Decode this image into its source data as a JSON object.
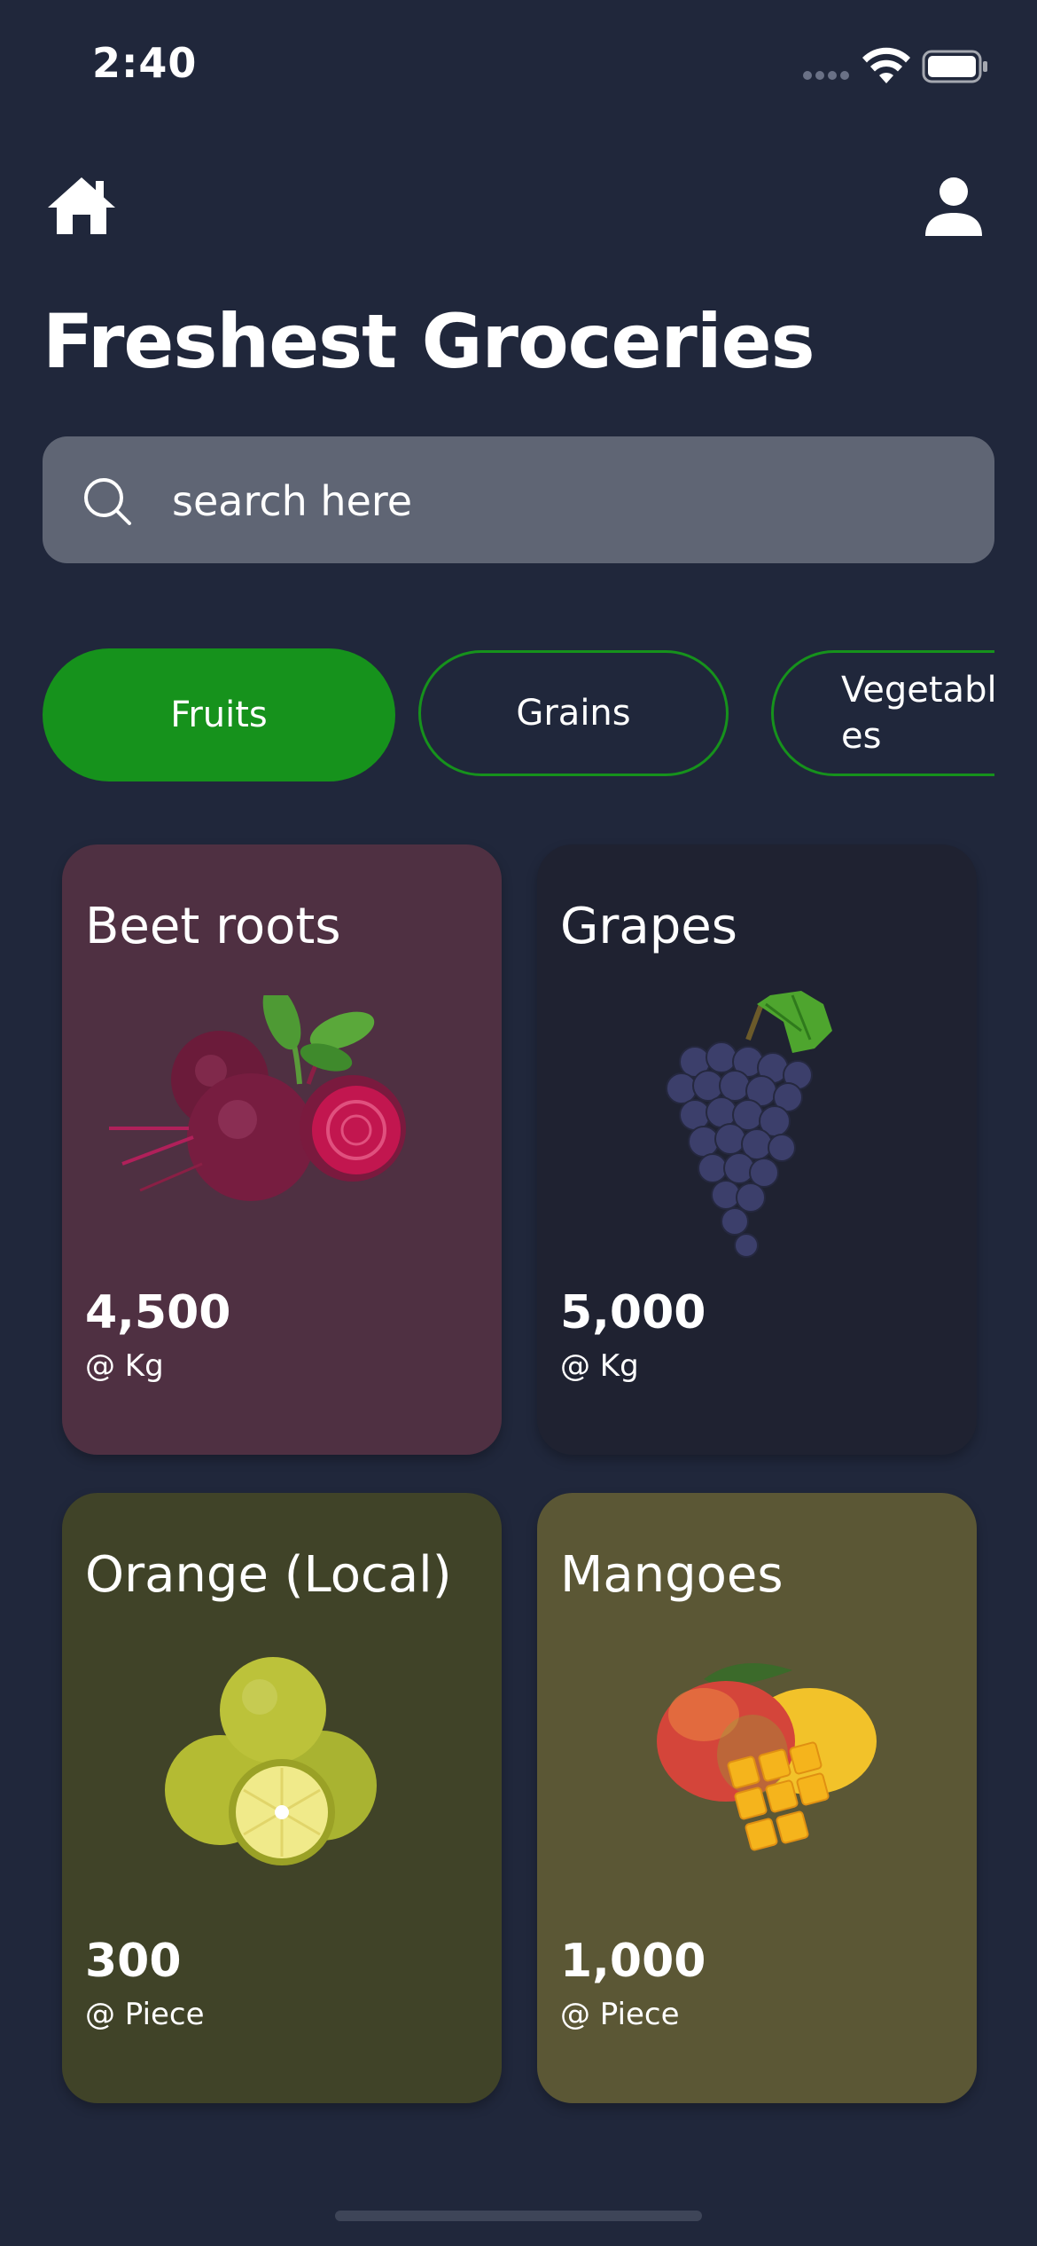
{
  "status_bar": {
    "time": "2:40"
  },
  "header": {
    "title": "Freshest Groceries"
  },
  "search": {
    "placeholder": "search here"
  },
  "categories": [
    {
      "label": "Fruits",
      "selected": true
    },
    {
      "label": "Grains",
      "selected": false
    },
    {
      "label": "Vegetables",
      "selected": false
    }
  ],
  "products": [
    {
      "name": "Beet roots",
      "price": "4,500",
      "unit": "@ Kg",
      "bg_color": "#4f3042"
    },
    {
      "name": "Grapes",
      "price": "5,000",
      "unit": "@ Kg",
      "bg_color": "#1f2231"
    },
    {
      "name": "Orange (Local)",
      "price": "300",
      "unit": "@ Piece",
      "bg_color": "#404328"
    },
    {
      "name": "Mangoes",
      "price": "1,000",
      "unit": "@ Piece",
      "bg_color": "#5b5735"
    }
  ],
  "colors": {
    "background": "#20273b",
    "accent": "#16921c",
    "search_bg": "#5f6574"
  },
  "icons": [
    "home-icon",
    "user-icon",
    "search-icon",
    "wifi-icon",
    "battery-icon"
  ]
}
